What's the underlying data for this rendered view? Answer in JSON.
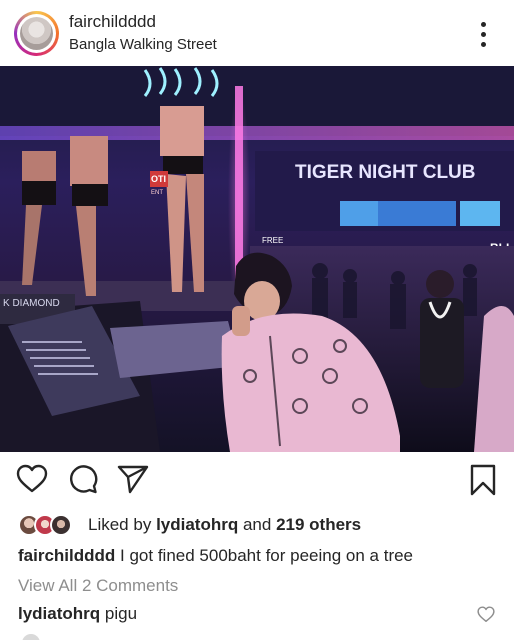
{
  "post": {
    "username": "fairchildddd",
    "location": "Bangla Walking Street"
  },
  "photo": {
    "signs": {
      "club": "TIGER NIGHT CLUB",
      "diamond": "K DIAMOND",
      "cut_left": "OTI",
      "free": "FREE",
      "bli": "BLI",
      "small": "ENT"
    }
  },
  "icons": {
    "more": "more-options-icon",
    "like": "heart-icon",
    "comment": "comment-icon",
    "share": "paper-plane-icon",
    "save": "bookmark-icon",
    "comment_like": "small-heart-icon"
  },
  "likes": {
    "prefix": "Liked by",
    "user": "lydiatohrq",
    "middle": "and",
    "others": "219 others"
  },
  "caption": {
    "username": "fairchildddd",
    "text": "I got fined 500baht for peeing on a tree"
  },
  "view_all": "View All 2 Comments",
  "comments": [
    {
      "username": "lydiatohrq",
      "text": "pigu"
    }
  ],
  "colors": {
    "text": "#262626",
    "muted": "#8e8e8e",
    "neon_pink": "#ff4fd8",
    "neon_blue": "#5ab8ff"
  }
}
